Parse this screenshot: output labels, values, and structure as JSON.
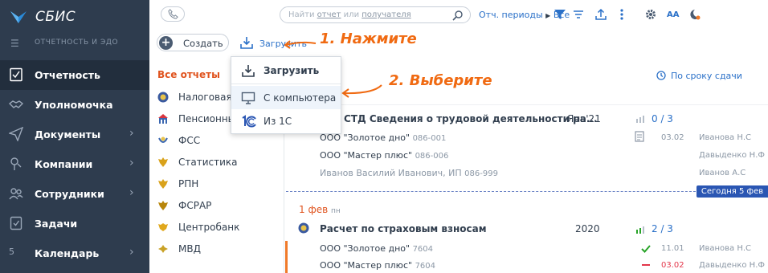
{
  "app": {
    "brand": "СБИС",
    "subtitle": "ОТЧЕТНОСТЬ И ЭДО"
  },
  "sidebar": {
    "items": [
      {
        "label": "Отчетность",
        "icon": "report-icon",
        "active": true
      },
      {
        "label": "Уполномочка",
        "icon": "handshake-icon"
      },
      {
        "label": "Документы",
        "icon": "paper-plane-icon"
      },
      {
        "label": "Компании",
        "icon": "companies-icon"
      },
      {
        "label": "Сотрудники",
        "icon": "employees-icon"
      },
      {
        "label": "Задачи",
        "icon": "tasks-icon"
      },
      {
        "label": "Календарь",
        "icon": "calendar-icon",
        "badge": "5"
      }
    ]
  },
  "toolbar": {
    "search_placeholder_prefix": "Найти ",
    "search_placeholder_report": "отчет",
    "search_placeholder_or": " или ",
    "search_placeholder_recipient": "получателя",
    "periods_label": "Отч. периоды",
    "periods_value": "Все",
    "create_label": "Создать",
    "upload_label": "Загрузить",
    "font_size_label": "AA"
  },
  "annotations": {
    "step1": "1. Нажмите",
    "step2": "2. Выберите"
  },
  "upload_menu": {
    "header": "Загрузить",
    "items": [
      {
        "label": "С компьютера",
        "icon": "monitor-icon"
      },
      {
        "label": "Из 1С",
        "icon": "1c-logo-icon"
      }
    ]
  },
  "filters": {
    "header": "Все отчеты",
    "items": [
      "Налоговая",
      "Пенсионный",
      "ФСС",
      "Статистика",
      "РПН",
      "ФСРАР",
      "Центробанк",
      "МВД"
    ]
  },
  "list": {
    "sort_label": "По сроку сдачи",
    "today_badge": "Сегодня 5 фев",
    "reports": [
      {
        "title": "СТД Сведения о трудовой деятельности ра...",
        "period": "Янв'21",
        "progress": "0 / 3",
        "rows": [
          {
            "org": "ООО \"Золотое дно\"",
            "code": "086-001",
            "date": "03.02",
            "person": "Иванова Н.С"
          },
          {
            "org": "ООО \"Мастер плюс\"",
            "code": "086-006",
            "date": "",
            "person": "Давыденко Н.Ф"
          },
          {
            "org": "Иванов Василий Иванович, ИП",
            "code": "086-999",
            "date": "",
            "person": "Иванов А.С"
          }
        ]
      },
      {
        "date_day": "1 фев",
        "date_dow": "пн",
        "title": "Расчет по страховым взносам",
        "period": "2020",
        "progress": "2 / 3",
        "rows": [
          {
            "org": "ООО \"Золотое дно\"",
            "code": "7604",
            "date": "11.01",
            "person": "Иванова Н.С",
            "status": "ok"
          },
          {
            "org": "ООО \"Мастер плюс\"",
            "code": "7604",
            "date": "03.02",
            "person": "Давыденко Н.Ф",
            "status": "error"
          }
        ]
      }
    ]
  },
  "colors": {
    "nav_bg": "#2e3c4e",
    "link": "#2a70c8",
    "accent_orange": "#e0541f",
    "annotation": "#f06a12",
    "today_badge": "#2a56b3",
    "success": "#27a327",
    "error": "#e3364a"
  }
}
